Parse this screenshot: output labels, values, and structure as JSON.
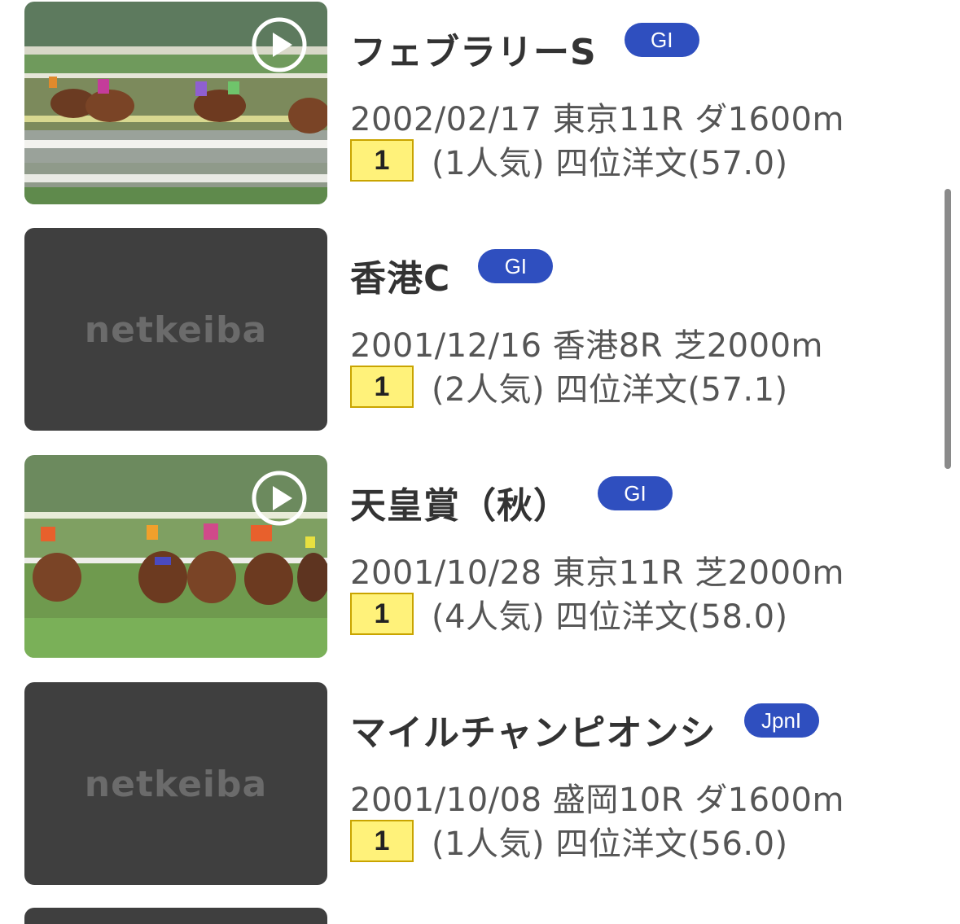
{
  "races": [
    {
      "name": "フェブラリーS",
      "grade": "GI",
      "date": "2002/02/17",
      "venue_race": "東京11R",
      "course": "ダ1600m",
      "rank": "1",
      "popularity": "(1人気)",
      "jockey": "四位洋文(57.0)",
      "thumbnail": "video",
      "play_icon": "play-icon"
    },
    {
      "name": "香港C",
      "grade": "GI",
      "date": "2001/12/16",
      "venue_race": "香港8R",
      "course": "芝2000m",
      "rank": "1",
      "popularity": "(2人気)",
      "jockey": "四位洋文(57.1)",
      "thumbnail": "placeholder",
      "placeholder_logo": "netkeiba"
    },
    {
      "name": "天皇賞（秋）",
      "grade": "GI",
      "date": "2001/10/28",
      "venue_race": "東京11R",
      "course": "芝2000m",
      "rank": "1",
      "popularity": "(4人気)",
      "jockey": "四位洋文(58.0)",
      "thumbnail": "video",
      "play_icon": "play-icon"
    },
    {
      "name": "マイルチャンピオンシ",
      "grade": "JpnI",
      "date": "2001/10/08",
      "venue_race": "盛岡10R",
      "course": "ダ1600m",
      "rank": "1",
      "popularity": "(1人気)",
      "jockey": "四位洋文(56.0)",
      "thumbnail": "placeholder",
      "placeholder_logo": "netkeiba"
    }
  ],
  "colors": {
    "grade_badge": "#2f4fbf",
    "rank_fill": "#fff27a",
    "rank_border": "#c9a400",
    "placeholder_bg": "#3f3f3f",
    "text_primary": "#333333",
    "text_secondary": "#555555"
  }
}
